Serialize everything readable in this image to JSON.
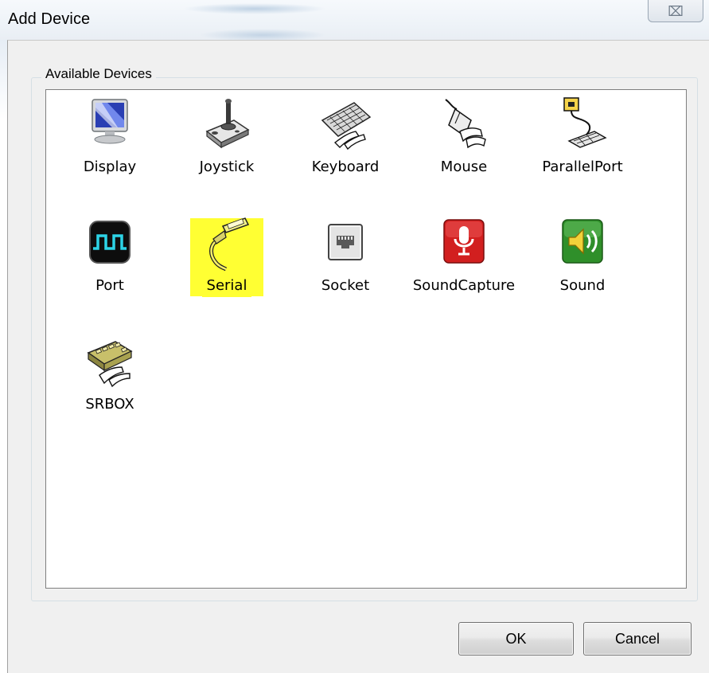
{
  "window": {
    "title": "Add Device",
    "close_glyph": "⌧"
  },
  "group": {
    "label": "Available Devices"
  },
  "devices": [
    {
      "label": "Display",
      "icon": "display-monitor-icon",
      "selected": false
    },
    {
      "label": "Joystick",
      "icon": "joystick-icon",
      "selected": false
    },
    {
      "label": "Keyboard",
      "icon": "keyboard-icon",
      "selected": false
    },
    {
      "label": "Mouse",
      "icon": "mouse-icon",
      "selected": false
    },
    {
      "label": "ParallelPort",
      "icon": "parallel-port-icon",
      "selected": false
    },
    {
      "label": "Port",
      "icon": "port-waveform-icon",
      "selected": false
    },
    {
      "label": "Serial",
      "icon": "serial-cable-icon",
      "selected": true
    },
    {
      "label": "Socket",
      "icon": "network-socket-icon",
      "selected": false
    },
    {
      "label": "SoundCapture",
      "icon": "microphone-icon",
      "selected": false
    },
    {
      "label": "Sound",
      "icon": "speaker-icon",
      "selected": false
    },
    {
      "label": "SRBOX",
      "icon": "srbox-keypad-icon",
      "selected": false
    }
  ],
  "buttons": {
    "ok_label": "OK",
    "cancel_label": "Cancel"
  },
  "colors": {
    "selection_highlight": "#ffff33",
    "dialog_background": "#f0f0f0"
  }
}
